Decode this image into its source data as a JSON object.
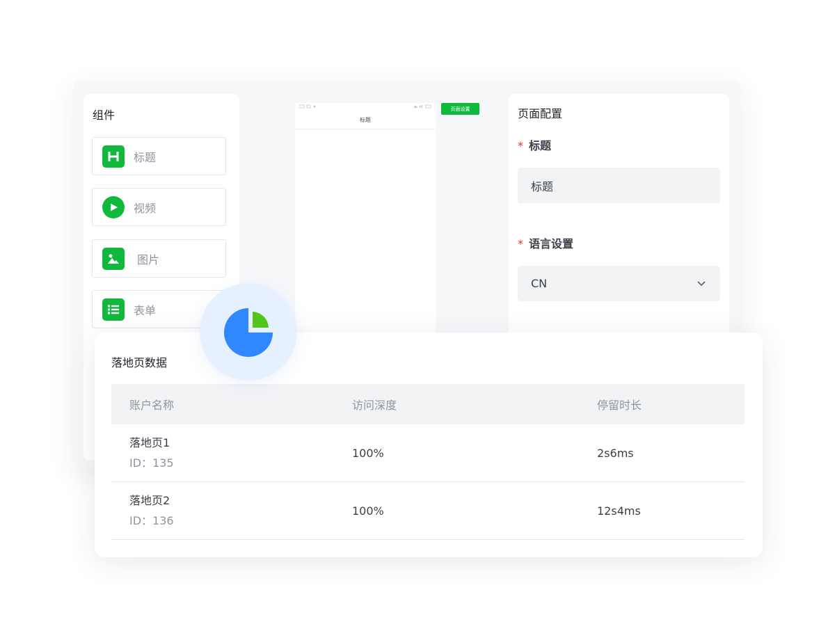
{
  "components": {
    "title": "组件",
    "items": [
      {
        "label": "标题",
        "icon": "heading-icon"
      },
      {
        "label": "视频",
        "icon": "play-icon"
      },
      {
        "label": "图片",
        "icon": "image-icon"
      },
      {
        "label": "表单",
        "icon": "list-icon"
      }
    ]
  },
  "preview": {
    "nav_title": "标题",
    "page_setting_button": "页面设置"
  },
  "config": {
    "title": "页面配置",
    "title_field": {
      "label": "标题",
      "value": "标题"
    },
    "language_field": {
      "label": "语言设置",
      "value": "CN"
    },
    "required_mark": "*"
  },
  "data_card": {
    "title": "落地页数据",
    "columns": [
      "账户名称",
      "访问深度",
      "停留时长"
    ],
    "rows": [
      {
        "name": "落地页1",
        "id": "ID：135",
        "depth": "100%",
        "duration": "2s6ms"
      },
      {
        "name": "落地页2",
        "id": "ID：136",
        "depth": "100%",
        "duration": "12s4ms"
      }
    ]
  },
  "colors": {
    "brand_green": "#10b93c",
    "pie_blue": "#2f88ff",
    "pie_green": "#52c41a",
    "circle_bg": "#e6f0fe"
  }
}
